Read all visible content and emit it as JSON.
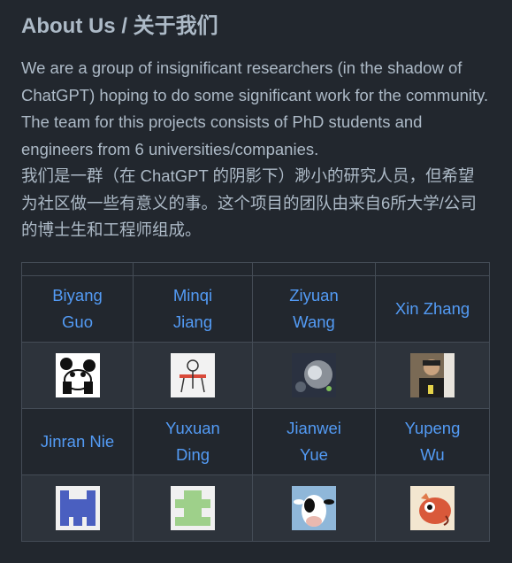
{
  "heading": "About Us / 关于我们",
  "paragraph_en": "We are a group of insignificant researchers (in the shadow of ChatGPT) hoping to do some significant work for the community. The team for this projects consists of PhD students and engineers from 6 universities/companies.",
  "paragraph_zh": "我们是一群（在 ChatGPT 的阴影下）渺小的研究人员，但希望为社区做一些有意义的事。这个项目的团队由来自6所大学/公司的博士生和工程师组成。",
  "members_row1": [
    {
      "first": "Biyang",
      "last": "Guo",
      "avatar": "panda-avatar"
    },
    {
      "first": "Minqi",
      "last": "Jiang",
      "avatar": "cartoon-avatar"
    },
    {
      "first": "Ziyuan",
      "last": "Wang",
      "avatar": "space-avatar"
    },
    {
      "first": "Xin Zhang",
      "last": "",
      "avatar": "photo-avatar"
    }
  ],
  "members_row2": [
    {
      "first": "Jinran Nie",
      "last": "",
      "avatar": "identicon-blue-avatar"
    },
    {
      "first": "Yuxuan",
      "last": "Ding",
      "avatar": "identicon-green-avatar"
    },
    {
      "first": "Jianwei",
      "last": "Yue",
      "avatar": "cow-avatar"
    },
    {
      "first": "Yupeng",
      "last": "Wu",
      "avatar": "fish-avatar"
    }
  ]
}
